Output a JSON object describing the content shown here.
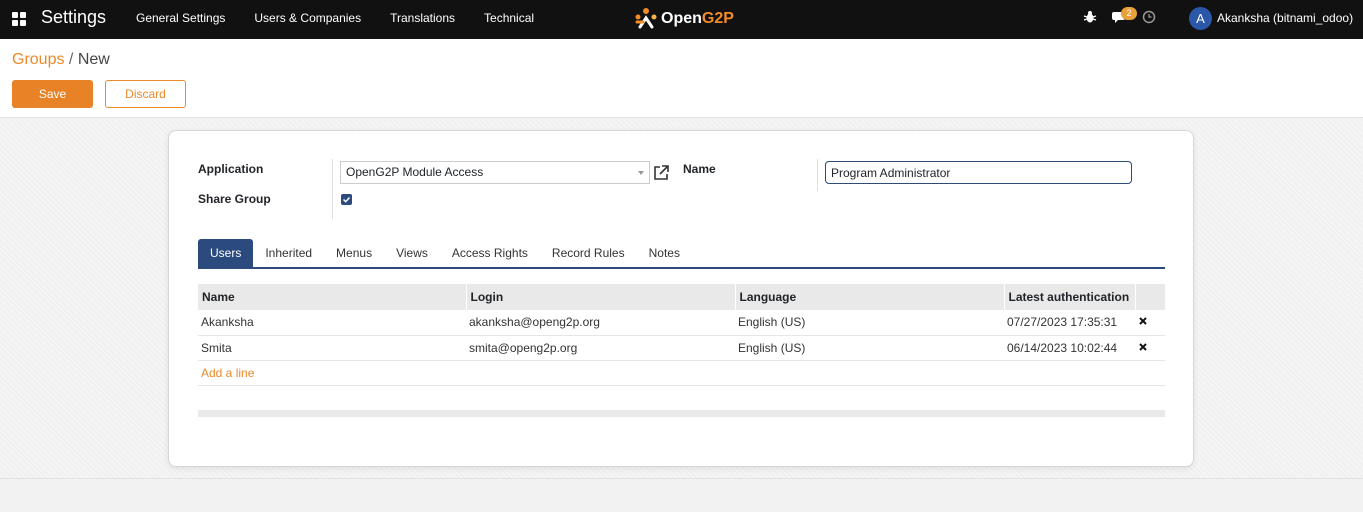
{
  "navbar": {
    "app_title": "Settings",
    "menu": [
      "General Settings",
      "Users & Companies",
      "Translations",
      "Technical"
    ],
    "logo_text_a": "Open",
    "logo_text_b": "G2P",
    "chat_badge": "2",
    "avatar_initial": "A",
    "user_name": "Akanksha (bitnami_odoo)"
  },
  "breadcrumb": {
    "parent": "Groups",
    "separator": " / ",
    "current": "New"
  },
  "buttons": {
    "save": "Save",
    "discard": "Discard"
  },
  "form": {
    "application_label": "Application",
    "application_value": "OpenG2P Module Access",
    "share_group_label": "Share Group",
    "share_group_checked": true,
    "name_label": "Name",
    "name_value": "Program Administrator"
  },
  "tabs": [
    "Users",
    "Inherited",
    "Menus",
    "Views",
    "Access Rights",
    "Record Rules",
    "Notes"
  ],
  "active_tab": "Users",
  "users_table": {
    "columns": [
      "Name",
      "Login",
      "Language",
      "Latest authentication"
    ],
    "rows": [
      {
        "name": "Akanksha",
        "login": "akanksha@openg2p.org",
        "language": "English (US)",
        "latest_auth": "07/27/2023 17:35:31"
      },
      {
        "name": "Smita",
        "login": "smita@openg2p.org",
        "language": "English (US)",
        "latest_auth": "06/14/2023 10:02:44"
      }
    ],
    "add_line": "Add a line"
  },
  "colors": {
    "accent": "#e88226",
    "primary": "#2b4a7e",
    "navbar": "#111111"
  },
  "icons": [
    "apps-grid-icon",
    "bug-icon",
    "chat-icon",
    "clock-icon",
    "external-link-icon",
    "delete-x-icon",
    "checkbox-check-icon"
  ]
}
